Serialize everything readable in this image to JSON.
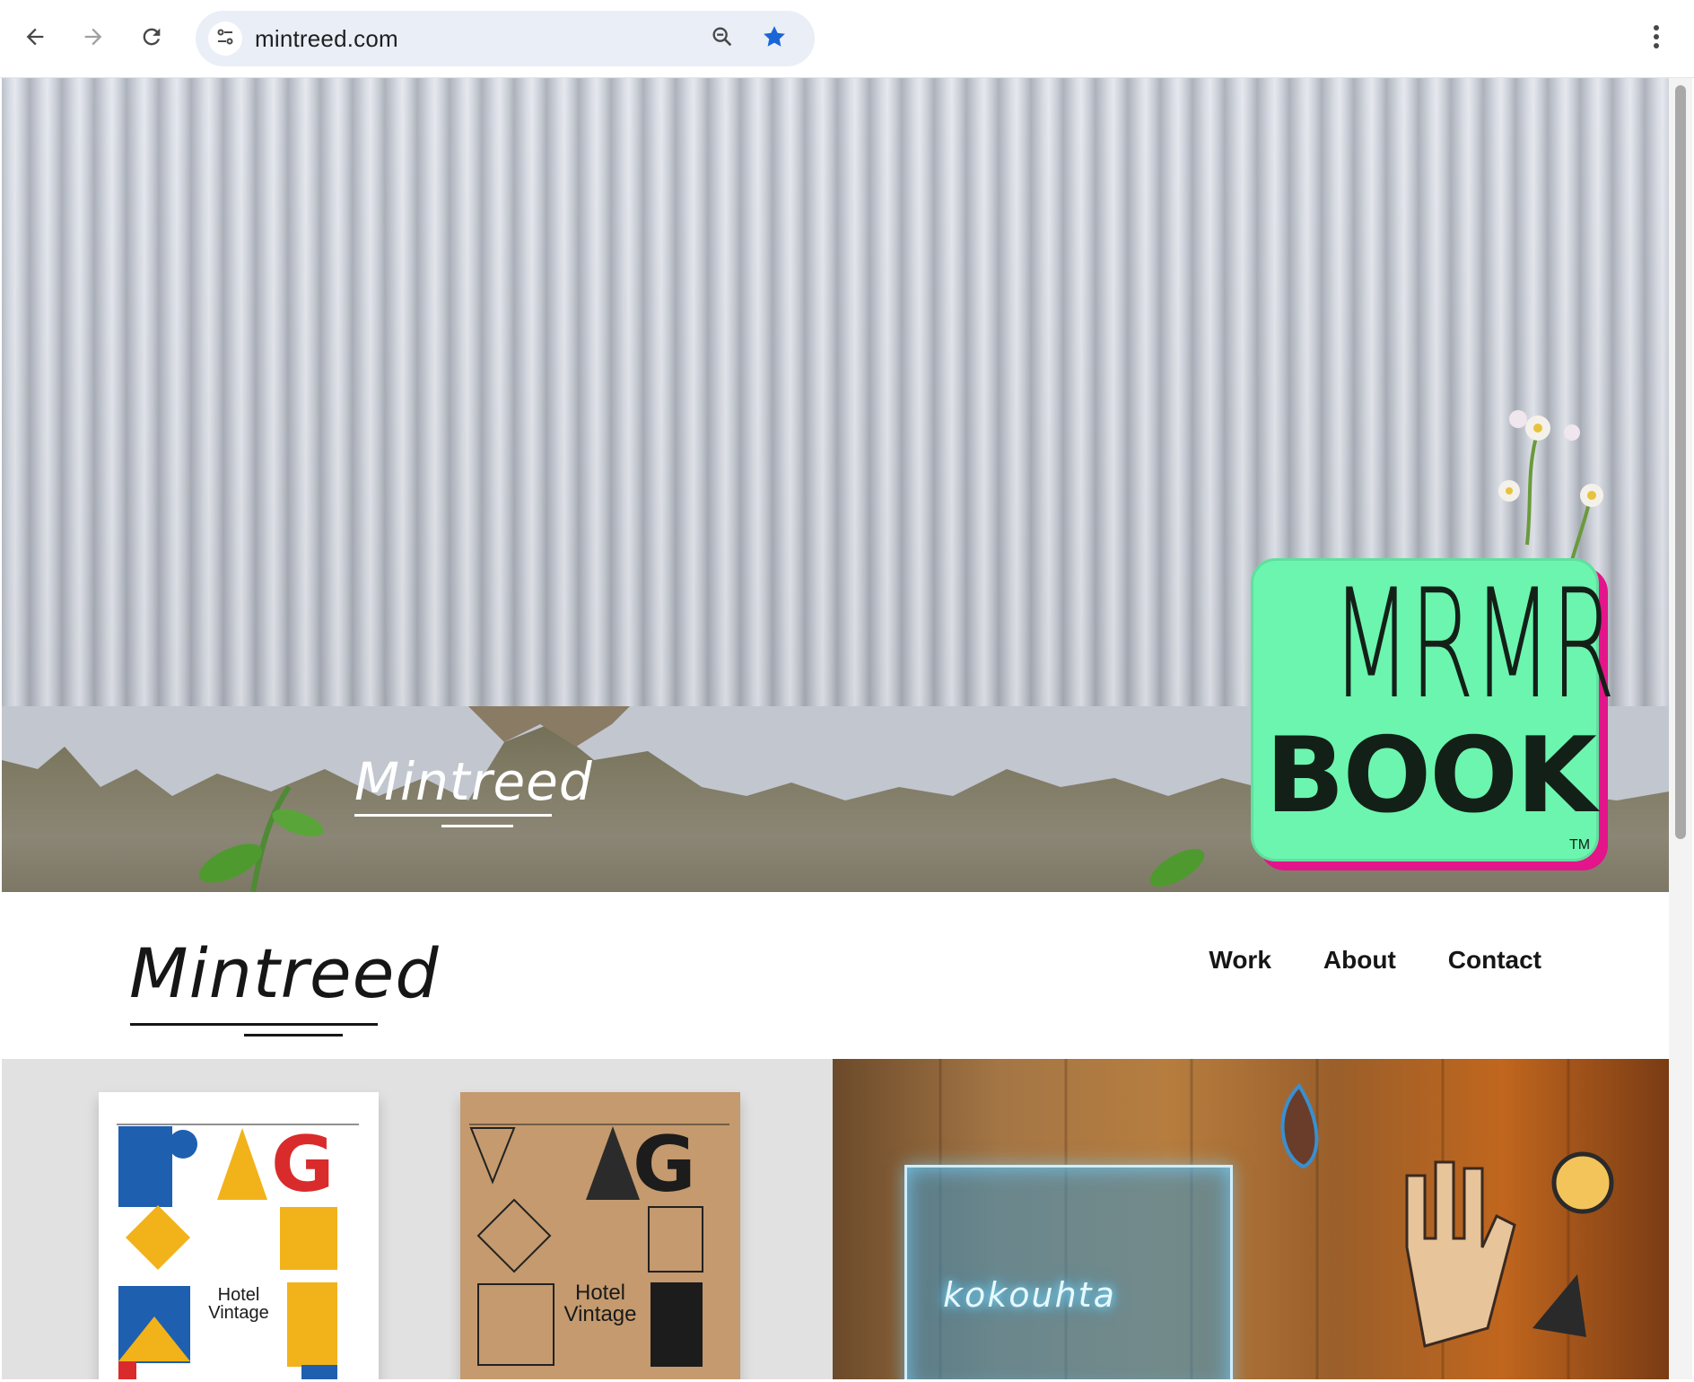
{
  "browser": {
    "url": "mintreed.com",
    "icons": {
      "back": "arrow-left-icon",
      "forward": "arrow-right-icon",
      "reload": "reload-icon",
      "site_info": "tune-icon",
      "zoom": "zoom-icon",
      "bookmark": "star-icon",
      "menu": "kebab-menu-icon"
    },
    "bookmark_color": "#1a66d6"
  },
  "hero": {
    "logo_text": "Mintreed",
    "sticker": {
      "top_text": "MRMR",
      "bottom_text": "BOOK",
      "tm": "TM",
      "colors": {
        "fill": "#6cf5ae",
        "shadow": "#e4148a",
        "ink": "#132018"
      }
    }
  },
  "site": {
    "brand": "Mintreed",
    "nav": [
      {
        "label": "Work"
      },
      {
        "label": "About"
      },
      {
        "label": "Contact"
      }
    ]
  },
  "work": {
    "tiles": [
      {
        "poster_labels": [
          "Hotel\nVintage",
          "Hotel\nVintage"
        ]
      },
      {
        "sign_text": "kokouhta"
      }
    ]
  }
}
